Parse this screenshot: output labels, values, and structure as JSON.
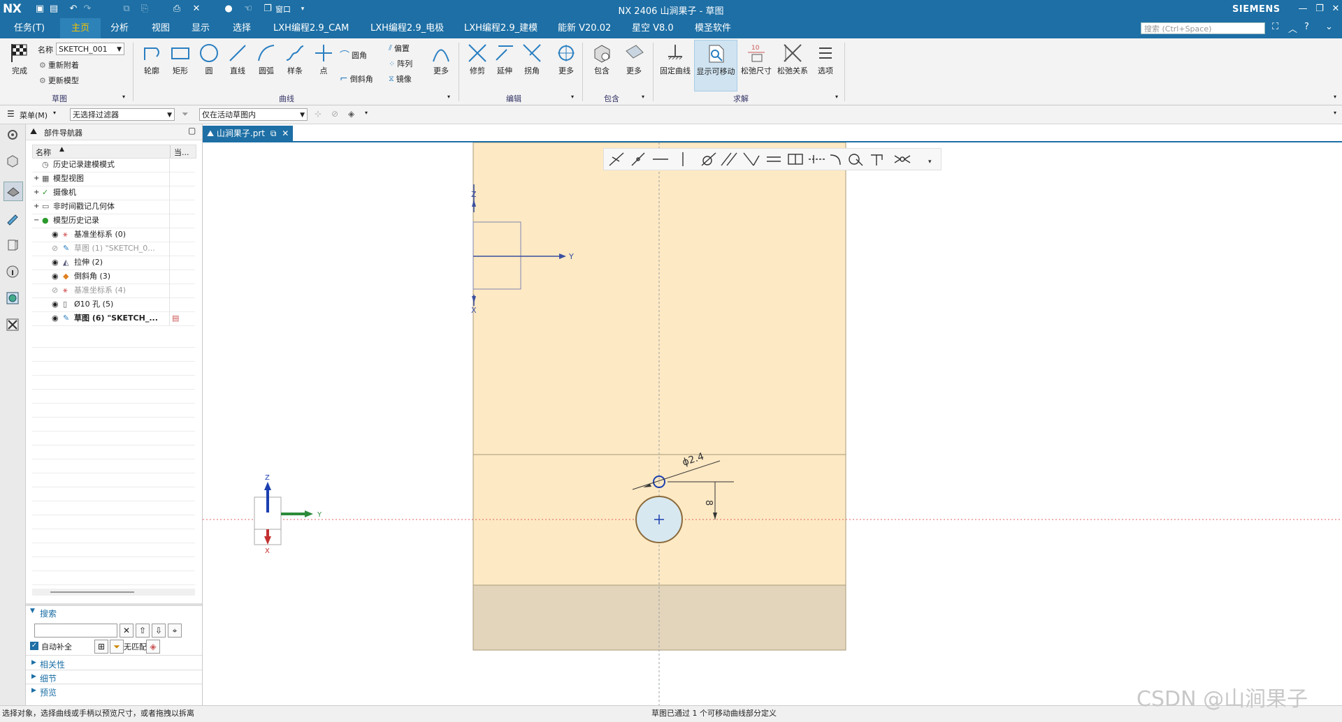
{
  "titlebar": {
    "logo": "NX",
    "title": "NX 2406 山涧果子 - 草图",
    "brand": "SIEMENS",
    "window_label": "窗口"
  },
  "menu": {
    "tabs": [
      "任务(T)",
      "主页",
      "分析",
      "视图",
      "显示",
      "选择",
      "LXH编程2.9_CAM",
      "LXH编程2.9_电极",
      "LXH编程2.9_建模",
      "能新 V20.02",
      "星空 V8.0",
      "模圣软件"
    ],
    "active": "主页",
    "search_placeholder": "搜索 (Ctrl+Space)"
  },
  "ribbon": {
    "sketch_group": {
      "finish_label": "完成",
      "name_label": "名称",
      "name_value": "SKETCH_001",
      "reattach_label": "重新附着",
      "update_label": "更新模型",
      "group_label": "草图"
    },
    "curve_group": {
      "buttons": [
        "轮廓",
        "矩形",
        "圆",
        "直线",
        "圆弧",
        "样条",
        "点"
      ],
      "fillet_label": "圆角",
      "chamfer_label": "倒斜角",
      "offset_label": "偏置",
      "pattern_label": "阵列",
      "mirror_label": "镜像",
      "more_label": "更多",
      "group_label": "曲线"
    },
    "edit_group": {
      "buttons": [
        "修剪",
        "延伸",
        "拐角",
        "更多"
      ],
      "group_label": "编辑"
    },
    "include_group": {
      "buttons": [
        "包含",
        "更多"
      ],
      "group_label": "包含"
    },
    "solve_group": {
      "buttons": [
        "固定曲线",
        "显示可移动",
        "松弛尺寸",
        "松弛关系",
        "选项"
      ],
      "highlighted": "显示可移动",
      "group_label": "求解"
    }
  },
  "selbar": {
    "menu_label": "菜单(M)",
    "filter_value": "无选择过滤器",
    "scope_value": "仅在活动草图内"
  },
  "navigator": {
    "title": "部件导航器",
    "col_name": "名称",
    "col_current": "当...",
    "rows": [
      {
        "label": "历史记录建模模式",
        "indent": 0,
        "icon": "clock"
      },
      {
        "label": "模型视图",
        "indent": 0,
        "icon": "views"
      },
      {
        "label": "摄像机",
        "indent": 0,
        "icon": "camera"
      },
      {
        "label": "非时间戳记几何体",
        "indent": 0,
        "icon": "folder"
      },
      {
        "label": "模型历史记录",
        "indent": 0,
        "icon": "history"
      },
      {
        "label": "基准坐标系 (0)",
        "indent": 1,
        "icon": "csys"
      },
      {
        "label": "草图 (1) \"SKETCH_0...",
        "indent": 1,
        "icon": "sketch"
      },
      {
        "label": "拉伸 (2)",
        "indent": 1,
        "icon": "extrude"
      },
      {
        "label": "倒斜角 (3)",
        "indent": 1,
        "icon": "chamfer"
      },
      {
        "label": "基准坐标系 (4)",
        "indent": 1,
        "icon": "csys"
      },
      {
        "label": "Ø10 孔 (5)",
        "indent": 1,
        "icon": "hole"
      },
      {
        "label": "草图 (6) \"SKETCH_...",
        "indent": 1,
        "icon": "sketch"
      }
    ],
    "search_section": "搜索",
    "autocomplete_label": "自动补全",
    "nomatch_label": "无匹配",
    "sections": [
      "相关性",
      "细节",
      "预览"
    ]
  },
  "document": {
    "tab_label": "山涧果子.prt"
  },
  "graphics": {
    "dimension_diameter": "ϕ2.4",
    "dimension_vertical": "8",
    "axis_y": "Y",
    "axis_z": "Z",
    "axis_x": "X",
    "triad_y": "Y",
    "triad_z": "Z",
    "triad_x": "X",
    "part_color": "#fde9c4",
    "part_edge_color": "#a89a7a",
    "lower_part_color": "#e3d5bb",
    "circle_color": "#1c3fb0"
  },
  "status": {
    "left": "选择对象，选择曲线或手柄以预览尺寸，或者拖拽以拆离",
    "center": "草图已通过 1 个可移动曲线部分定义"
  },
  "watermark": "CSDN @山涧果子"
}
